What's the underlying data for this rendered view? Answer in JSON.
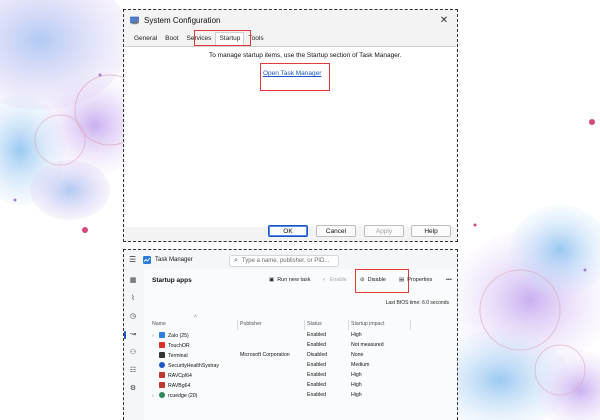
{
  "syscfg": {
    "title": "System Configuration",
    "close_glyph": "✕",
    "tabs": [
      "General",
      "Boot",
      "Services",
      "Startup",
      "Tools"
    ],
    "active_tab": "Startup",
    "message": "To manage startup items, use the Startup section of Task Manager.",
    "link": "Open Task Manager",
    "buttons": {
      "ok": "OK",
      "cancel": "Cancel",
      "apply": "Apply",
      "help": "Help"
    }
  },
  "taskmgr": {
    "title": "Task Manager",
    "search_placeholder": "Type a name, publisher, or PID...",
    "page_title": "Startup apps",
    "toolbar": {
      "run_new_task": "Run new task",
      "enable": "Enable",
      "disable": "Disable",
      "properties": "Properties",
      "more": "•••"
    },
    "bios_time": "Last BIOS time:  6.0 seconds",
    "columns": {
      "name": "Name",
      "publisher": "Publisher",
      "status": "Status",
      "impact": "Startup impact"
    },
    "rows": [
      {
        "name": "Zalo (25)",
        "publisher": "",
        "status": "Enabled",
        "impact": "High",
        "icon_color": "#2f7de1",
        "expandable": true
      },
      {
        "name": "TouchOR",
        "publisher": "",
        "status": "Enabled",
        "impact": "Not measured",
        "icon_color": "#d93025",
        "expandable": false
      },
      {
        "name": "Terminal",
        "publisher": "Microsoft Corporation",
        "status": "Disabled",
        "impact": "None",
        "icon_color": "#333333",
        "expandable": false
      },
      {
        "name": "SecurityHealthSystray",
        "publisher": "",
        "status": "Enabled",
        "impact": "Medium",
        "icon_color": "#1a56c7",
        "expandable": false
      },
      {
        "name": "RAVCpl64",
        "publisher": "",
        "status": "Enabled",
        "impact": "High",
        "icon_color": "#c0392b",
        "expandable": false
      },
      {
        "name": "RAVBg64",
        "publisher": "",
        "status": "Enabled",
        "impact": "High",
        "icon_color": "#c0392b",
        "expandable": false
      },
      {
        "name": "rcuedge (20)",
        "publisher": "",
        "status": "Enabled",
        "impact": "High",
        "icon_color": "#2e8b57",
        "expandable": true
      }
    ]
  },
  "colors": {
    "highlight": "#e03a3a",
    "link": "#1a56c7",
    "accent": "#1a56c7"
  }
}
